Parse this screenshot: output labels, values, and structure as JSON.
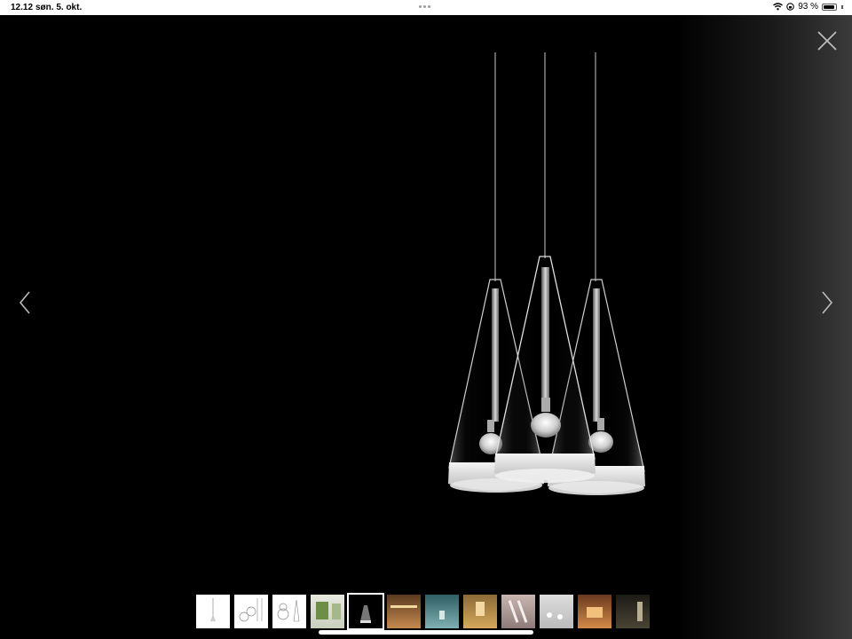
{
  "status": {
    "time": "12.12",
    "date": "søn. 5. okt.",
    "battery": "93 %",
    "battery_level": 0.93
  },
  "viewer": {
    "close_icon": "close-icon",
    "prev_icon": "chevron-left-icon",
    "next_icon": "chevron-right-icon",
    "background": "#000000",
    "image_subject": "three-cone-pendant-lamp"
  },
  "thumbnails": [
    {
      "id": "thumb-1",
      "style": "white-drawing"
    },
    {
      "id": "thumb-2",
      "style": "white-drawing"
    },
    {
      "id": "thumb-3",
      "style": "white-drawing"
    },
    {
      "id": "thumb-4",
      "style": "room-green"
    },
    {
      "id": "thumb-5",
      "style": "black-lamp",
      "selected": true
    },
    {
      "id": "thumb-6",
      "style": "warm-brown"
    },
    {
      "id": "thumb-7",
      "style": "teal"
    },
    {
      "id": "thumb-8",
      "style": "amber"
    },
    {
      "id": "thumb-9",
      "style": "pink-grey"
    },
    {
      "id": "thumb-10",
      "style": "light-grey"
    },
    {
      "id": "thumb-11",
      "style": "orange-room"
    },
    {
      "id": "thumb-12",
      "style": "dark-room"
    }
  ],
  "colors": {
    "statusbar_bg": "#ffffff",
    "viewer_bg": "#000000",
    "icon": "#bbbbbb"
  }
}
